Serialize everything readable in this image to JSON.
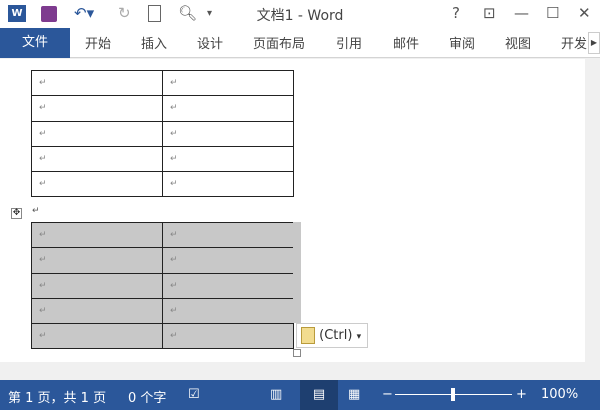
{
  "title": "文档1 - Word",
  "quick_access": {
    "word_icon": "W",
    "more": "▾"
  },
  "window_controls": {
    "help": "?",
    "restore": "⊡",
    "minimize": "—",
    "maximize": "☐",
    "close": "✕"
  },
  "ribbon": {
    "file": "文件",
    "tabs": [
      "开始",
      "插入",
      "设计",
      "页面布局",
      "引用",
      "邮件",
      "审阅",
      "视图",
      "开发"
    ]
  },
  "document": {
    "para_mark": "↵",
    "paste_options": "(Ctrl)",
    "paste_arrow": "▾"
  },
  "status": {
    "page": "第 1 页，共 1 页",
    "words": "0 个字",
    "zoom": "100%",
    "zoom_fraction": 0.5
  }
}
